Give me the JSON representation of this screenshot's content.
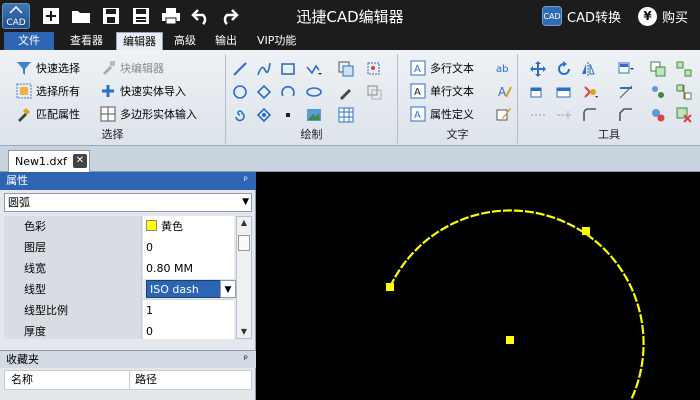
{
  "app": {
    "logo_text": "CAD",
    "title": "迅捷CAD编辑器",
    "cad_convert": "CAD转换",
    "buy": "购买",
    "cad_convert_icon_text": "CAD",
    "yen": "¥"
  },
  "menu": {
    "file": "文件",
    "tabs": [
      "查看器",
      "编辑器",
      "高级",
      "输出",
      "VIP功能"
    ],
    "active_index": 1
  },
  "ribbon": {
    "select_group": {
      "label": "选择",
      "quick_select": "快速选择",
      "select_all": "选择所有",
      "match_props": "匹配属性",
      "block_editor": "块编辑器",
      "quick_entity_import": "快速实体导入",
      "polygon_entity_input": "多边形实体输入"
    },
    "draw_group": {
      "label": "绘制"
    },
    "text_group": {
      "label": "文字",
      "mtext": "多行文本",
      "stext": "单行文本",
      "attdef": "属性定义"
    },
    "tools_group": {
      "label": "工具"
    }
  },
  "document": {
    "tab": "New1.dxf",
    "close": "✕"
  },
  "properties": {
    "title": "属性",
    "pin": "ᵖ",
    "object_type": "圆弧",
    "rows": [
      {
        "name": "色彩",
        "value": "黄色"
      },
      {
        "name": "图层",
        "value": "0"
      },
      {
        "name": "线宽",
        "value": "0.80 MM"
      },
      {
        "name": "线型",
        "value": "ISO dash"
      },
      {
        "name": "线型比例",
        "value": "1"
      },
      {
        "name": "厚度",
        "value": "0"
      }
    ],
    "color_swatch": "#ffff00"
  },
  "favorites": {
    "title": "收藏夹",
    "pin": "ᵖ",
    "col_name": "名称",
    "col_path": "路径"
  },
  "drawing": {
    "arc_color": "#ffff00",
    "background": "#000000"
  }
}
